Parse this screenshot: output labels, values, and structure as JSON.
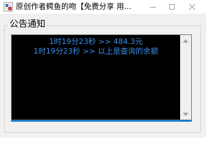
{
  "window": {
    "title": "原创作者鳄鱼的吻【免费分享 用...",
    "accent_color": "#0078d7",
    "icons": {
      "app": "app-icon",
      "minimize": "minimize-icon",
      "maximize": "maximize-icon",
      "close": "close-icon"
    }
  },
  "notice": {
    "group_label": "公告通知",
    "lines": [
      "1时19分23秒 >> 484.3元",
      "1时19分23秒 >> 以上是查询的余额"
    ],
    "text_color": "#3a8be6",
    "background_color": "#000000"
  }
}
